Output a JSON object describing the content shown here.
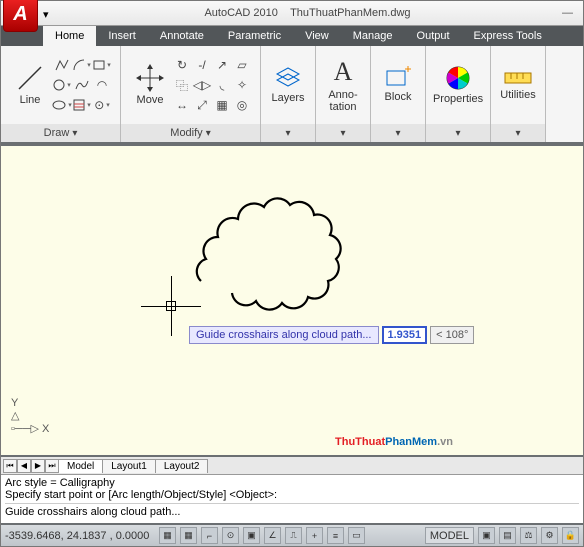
{
  "titlebar": {
    "app_name": "AutoCAD 2010",
    "file_name": "ThuThuatPhanMem.dwg"
  },
  "tabs": [
    "Home",
    "Insert",
    "Annotate",
    "Parametric",
    "View",
    "Manage",
    "Output",
    "Express Tools"
  ],
  "active_tab": "Home",
  "ribbon": {
    "draw": {
      "title": "Draw",
      "big": "Line"
    },
    "modify": {
      "title": "Modify",
      "big": "Move"
    },
    "layers": "Layers",
    "anno": "Anno-\ntation",
    "block": "Block",
    "props": "Properties",
    "util": "Utilities"
  },
  "canvas": {
    "hint": "Guide crosshairs along cloud path...",
    "distance": "1.9351",
    "angle": "<  108°",
    "ucs_y": "Y",
    "ucs_x": "X"
  },
  "layout_tabs": [
    "Model",
    "Layout1",
    "Layout2"
  ],
  "cmd": {
    "l1": "Arc style = Calligraphy",
    "l2": "Specify start point or [Arc length/Object/Style] <Object>:",
    "l3": "Guide crosshairs along cloud path..."
  },
  "status": {
    "coords": "-3539.6468, 24.1837 , 0.0000",
    "model": "MODEL"
  },
  "watermark": {
    "a": "ThuThuat",
    "b": "PhanMem",
    "c": ".vn"
  }
}
